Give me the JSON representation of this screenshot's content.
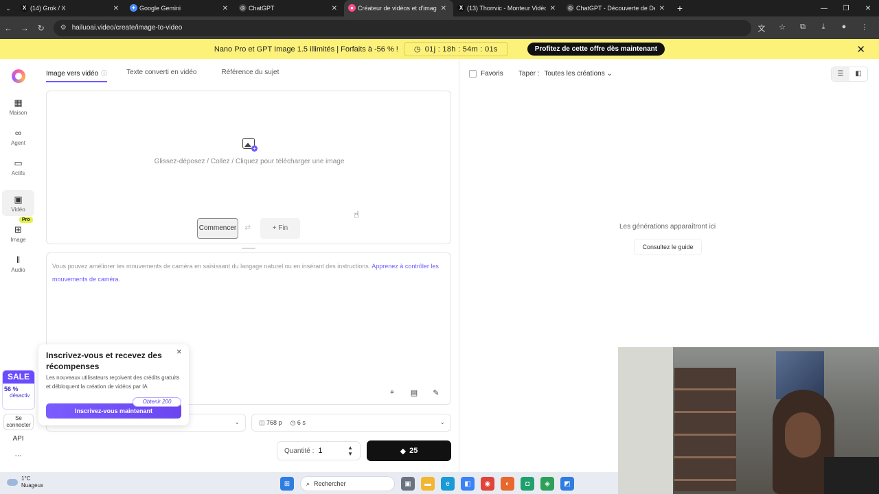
{
  "browser": {
    "tabs": [
      {
        "title": "(14) Grok / X",
        "icon": "x-logo-icon",
        "color": "#111111",
        "active": false
      },
      {
        "title": "Google Gemini",
        "icon": "gemini-icon",
        "color": "#4a8cff",
        "active": false
      },
      {
        "title": "ChatGPT",
        "icon": "chatgpt-icon",
        "color": "#444444",
        "active": false
      },
      {
        "title": "Créateur de vidéos et d'images",
        "icon": "hailuo-icon",
        "color": "#ff4f8b",
        "active": true
      },
      {
        "title": "(13) Thorrvic - Monteur Vidéo",
        "icon": "x-logo-icon",
        "color": "#111111",
        "active": false
      },
      {
        "title": "ChatGPT - Découverte de Detr",
        "icon": "chatgpt-icon",
        "color": "#444444",
        "active": false
      }
    ],
    "url": "hailuoai.video/create/image-to-video"
  },
  "promo": {
    "text": "Nano Pro et GPT Image 1.5 illimités | Forfaits à -56 % !",
    "timer": "01j : 18h : 54m : 01s",
    "cta": "Profitez de cette offre dès maintenant",
    "bg_color": "#fcf27a"
  },
  "sidebar": {
    "items": [
      {
        "label": "Maison",
        "icon": "calendar-home-icon"
      },
      {
        "label": "Agent",
        "icon": "infinity-icon"
      },
      {
        "label": "Actifs",
        "icon": "folder-icon"
      },
      {
        "label": "Vidéo",
        "icon": "video-camera-icon"
      },
      {
        "label": "Image",
        "icon": "image-plus-icon"
      },
      {
        "label": "Audio",
        "icon": "audio-wave-icon"
      }
    ],
    "pro_badge": "Pro",
    "sale": {
      "title": "SALE",
      "pct": "56 %",
      "sub": "désactiv"
    },
    "login": "Se connecter",
    "api": "API",
    "more": "..."
  },
  "main": {
    "tabs": [
      {
        "label": "Image vers vidéo",
        "active": true
      },
      {
        "label": "Texte converti en vidéo",
        "active": false
      },
      {
        "label": "Référence du sujet",
        "active": false
      }
    ],
    "upload_hint": "Glissez-déposez / Collez / Cliquez pour télécharger une image",
    "start_label": "Commencer",
    "end_label": "+ Fin",
    "prompt_placeholder": "Vous pouvez améliorer les mouvements de caméra en saisissant du langage naturel ou en insérant des instructions.",
    "prompt_link": "Apprenez à contrôler les mouvements de caméra.",
    "resolution": "768 p",
    "duration": "6 s",
    "quantity_label": "Quantité :",
    "quantity_value": "1",
    "generate_cost": "25",
    "accent_color": "#6d5cff"
  },
  "right": {
    "favorites_label": "Favoris",
    "type_label": "Taper :",
    "type_value": "Toutes les créations",
    "empty_text": "Les générations apparaîtront ici",
    "guide_button": "Consultez le guide"
  },
  "signup_popup": {
    "title": "Inscrivez-vous et recevez des récompenses",
    "desc": "Les nouveaux utilisateurs reçoivent des crédits gratuits et débloquent la création de vidéos par IA",
    "chip": "Obtenir 200",
    "button": "Inscrivez-vous maintenant"
  },
  "taskbar": {
    "temperature": "1°C",
    "weather": "Nuageux",
    "search": "Rechercher"
  }
}
